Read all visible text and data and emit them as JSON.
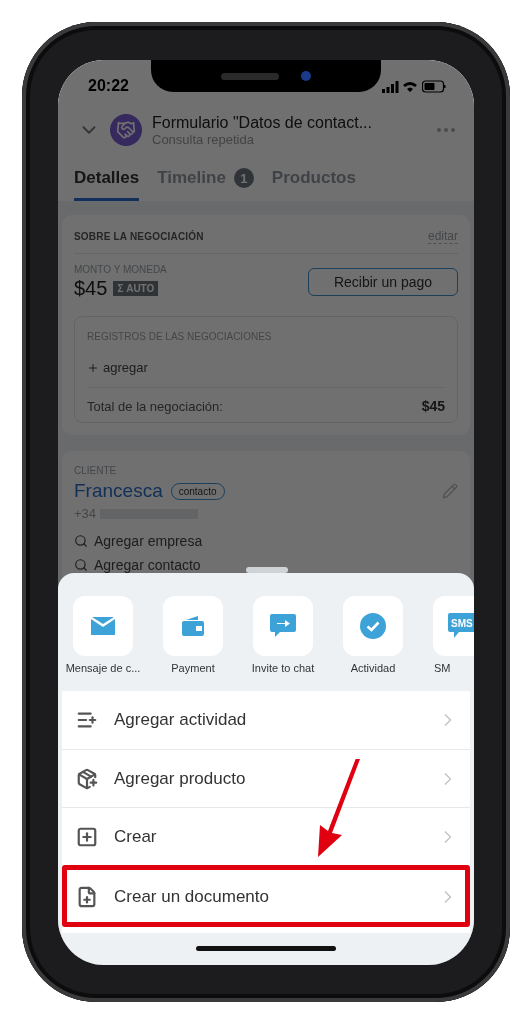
{
  "status_bar": {
    "time": "20:22"
  },
  "header": {
    "title": "Formulario \"Datos de contact...",
    "subtitle": "Consulta repetida"
  },
  "tabs": [
    {
      "label": "Detalles",
      "selected": true
    },
    {
      "label": "Timeline",
      "selected": false,
      "badge": "1"
    },
    {
      "label": "Productos",
      "selected": false
    }
  ],
  "deal_card": {
    "title": "SOBRE LA NEGOCIACIÓN",
    "edit_link": "editar",
    "amount_label": "MONTO Y MONEDA",
    "amount": "$45",
    "auto_badge": "Σ AUTO",
    "pay_button": "Recibir un pago",
    "records": {
      "title": "REGISTROS DE LAS NEGOCIACIONES",
      "add": "agregar",
      "total_label": "Total de la negociación:",
      "total": "$45"
    }
  },
  "client_card": {
    "label": "CLIENTE",
    "name": "Francesca",
    "tag": "contacto",
    "phone": "+34",
    "links": [
      "Agregar empresa",
      "Agregar contacto"
    ]
  },
  "action_sheet": {
    "open": true,
    "actions": [
      {
        "kind": "mail",
        "label": "Mensaje de c..."
      },
      {
        "kind": "wallet",
        "label": "Payment"
      },
      {
        "kind": "invite",
        "label": "Invite to chat"
      },
      {
        "kind": "check",
        "label": "Actividad"
      },
      {
        "kind": "sms",
        "label": "SM",
        "icon_text": "SMS"
      }
    ],
    "items": [
      {
        "kind": "activity",
        "label": "Agregar actividad",
        "highlighted": false
      },
      {
        "kind": "product",
        "label": "Agregar producto",
        "highlighted": false
      },
      {
        "kind": "create",
        "label": "Crear",
        "highlighted": false
      },
      {
        "kind": "document",
        "label": "Crear un documento",
        "highlighted": true
      }
    ]
  }
}
